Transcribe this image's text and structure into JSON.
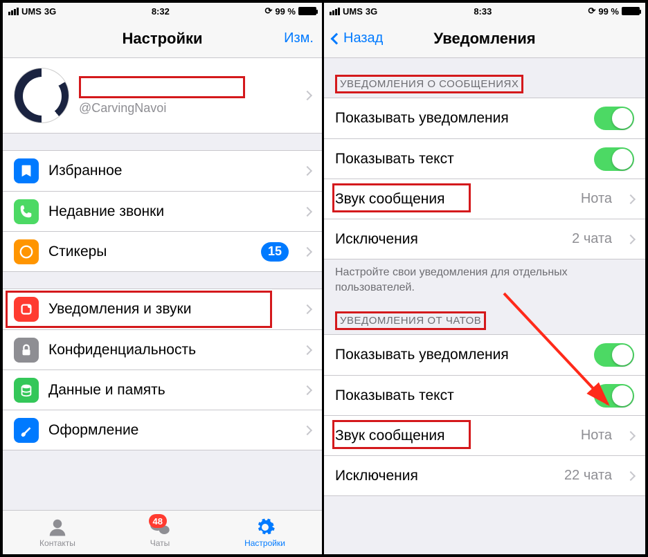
{
  "left": {
    "status": {
      "carrier": "UMS",
      "net": "3G",
      "time": "8:32",
      "battery": "99 %"
    },
    "nav": {
      "title": "Настройки",
      "edit": "Изм."
    },
    "profile": {
      "handle": "@CarvingNavoi"
    },
    "group1": {
      "fav": "Избранное",
      "calls": "Недавние звонки",
      "stickers": "Стикеры",
      "stickers_badge": "15"
    },
    "group2": {
      "notif": "Уведомления и звуки",
      "privacy": "Конфиденциальность",
      "data": "Данные и память",
      "appearance": "Оформление"
    },
    "tabs": {
      "contacts": "Контакты",
      "chats": "Чаты",
      "chats_badge": "48",
      "settings": "Настройки"
    }
  },
  "right": {
    "status": {
      "carrier": "UMS",
      "net": "3G",
      "time": "8:33",
      "battery": "99 %"
    },
    "nav": {
      "back": "Назад",
      "title": "Уведомления"
    },
    "sec1": {
      "head": "УВЕДОМЛЕНИЯ О СООБЩЕНИЯХ",
      "show": "Показывать уведомления",
      "text": "Показывать текст",
      "sound": "Звук сообщения",
      "sound_val": "Нота",
      "excl": "Исключения",
      "excl_val": "2 чата",
      "foot": "Настройте свои уведомления для отдельных пользователей."
    },
    "sec2": {
      "head": "УВЕДОМЛЕНИЯ ОТ ЧАТОВ",
      "show": "Показывать уведомления",
      "text": "Показывать текст",
      "sound": "Звук сообщения",
      "sound_val": "Нота",
      "excl": "Исключения",
      "excl_val": "22 чата"
    }
  }
}
